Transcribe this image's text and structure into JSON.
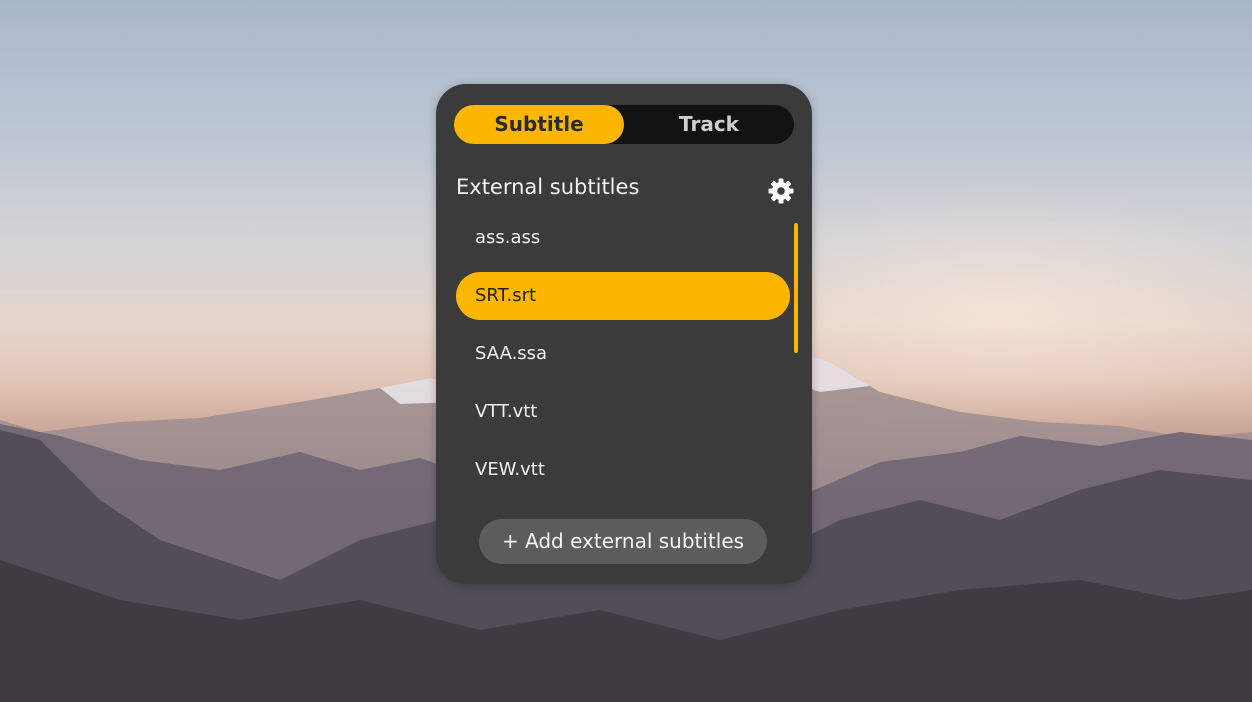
{
  "tabs": [
    {
      "label": "Subtitle",
      "active": true
    },
    {
      "label": "Track",
      "active": false
    }
  ],
  "section_title": "External subtitles",
  "settings_icon": "gear-icon",
  "subtitles": [
    {
      "label": "ass.ass",
      "selected": false
    },
    {
      "label": "SRT.srt",
      "selected": true
    },
    {
      "label": "SAA.ssa",
      "selected": false
    },
    {
      "label": "VTT.vtt",
      "selected": false
    },
    {
      "label": "VEW.vtt",
      "selected": false
    }
  ],
  "add_button_label": "+ Add external subtitles",
  "colors": {
    "accent": "#fdb600",
    "panel": "#3b3b3b",
    "tab_track_bg": "#121212",
    "button_bg": "#5c5c5c"
  }
}
